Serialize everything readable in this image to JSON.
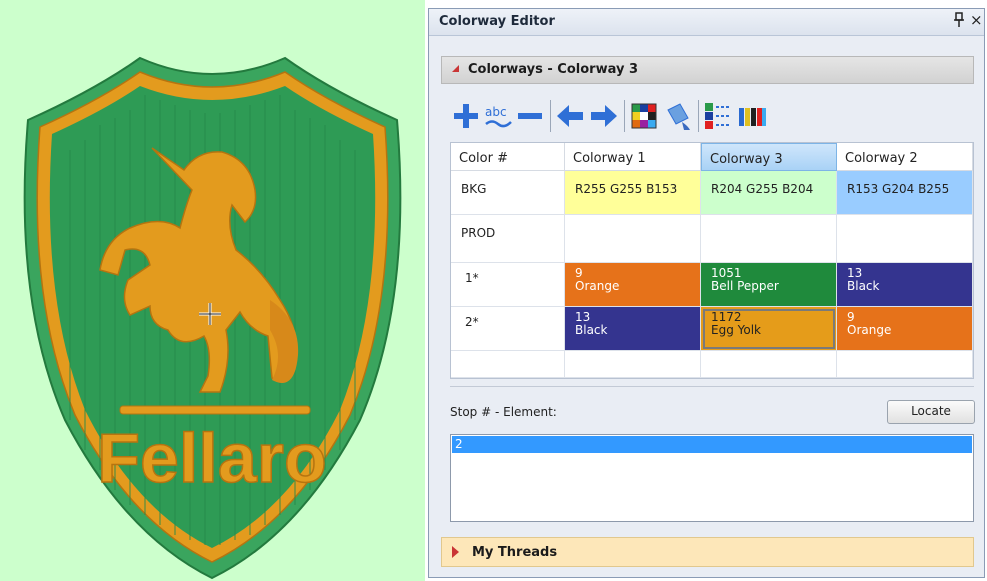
{
  "canvas": {
    "background_color": "#ccffcc",
    "logo_text": "Fellaro",
    "colors": {
      "shield_green": "#2e9b55",
      "thread_gold": "#e39b1e",
      "border_green": "#3aa55e"
    }
  },
  "panel": {
    "title": "Colorway Editor",
    "pin_icon": "pin-icon",
    "close_glyph": "×",
    "section_title": "Colorways - Colorway 3",
    "toolbar": [
      "add-icon",
      "rename-icon",
      "remove-icon",
      "move-left-icon",
      "move-right-icon",
      "color-grid-icon",
      "paint-icon",
      "numbered-list-icon",
      "thread-chart-icon"
    ],
    "table": {
      "headers": [
        "Color #",
        "Colorway 1",
        "Colorway 3",
        "Colorway 2"
      ],
      "selected_column": "Colorway 3",
      "rows": [
        {
          "label": "BKG",
          "cells": [
            {
              "line1": "R255 G255 B153",
              "line2": "",
              "bg": "#ffff99",
              "fg": "#222222"
            },
            {
              "line1": "R204 G255 B204",
              "line2": "",
              "bg": "#ccffcc",
              "fg": "#222222"
            },
            {
              "line1": "R153 G204 B255",
              "line2": "",
              "bg": "#99ccff",
              "fg": "#222222"
            }
          ]
        },
        {
          "label": "PROD",
          "cells": [
            {
              "line1": "",
              "line2": "",
              "bg": "#ffffff",
              "fg": "#222222"
            },
            {
              "line1": "",
              "line2": "",
              "bg": "#ffffff",
              "fg": "#222222"
            },
            {
              "line1": "",
              "line2": "",
              "bg": "#ffffff",
              "fg": "#222222"
            }
          ]
        },
        {
          "label": "1*",
          "cells": [
            {
              "line1": "9",
              "line2": "Orange",
              "bg": "#e6721a",
              "fg": "#ffffff"
            },
            {
              "line1": "1051",
              "line2": "Bell Pepper",
              "bg": "#1f8a3c",
              "fg": "#ffffff"
            },
            {
              "line1": "13",
              "line2": "Black",
              "bg": "#34348f",
              "fg": "#ffffff"
            }
          ]
        },
        {
          "label": "2*",
          "cells": [
            {
              "line1": "13",
              "line2": "Black",
              "bg": "#34348f",
              "fg": "#ffffff"
            },
            {
              "line1": "1172",
              "line2": "Egg Yolk",
              "bg": "#e59c1a",
              "fg": "#222222"
            },
            {
              "line1": "9",
              "line2": "Orange",
              "bg": "#e6721a",
              "fg": "#ffffff"
            }
          ]
        }
      ]
    },
    "stop_label": "Stop # - Element:",
    "locate_label": "Locate",
    "stop_list": [
      "2"
    ],
    "threads_title": "My Threads"
  }
}
